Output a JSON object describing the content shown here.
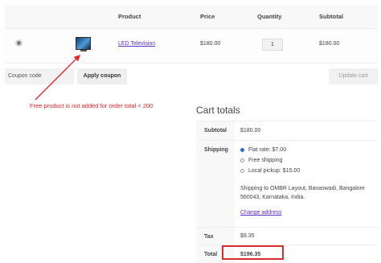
{
  "cart_table": {
    "headers": {
      "product": "Product",
      "price": "Price",
      "quantity": "Quantity",
      "subtotal": "Subtotal"
    },
    "rows": [
      {
        "product": "LED Television",
        "price": "$180.00",
        "quantity": "1",
        "subtotal": "$180.00"
      }
    ]
  },
  "actions": {
    "coupon_placeholder": "Coupon code",
    "apply_coupon": "Apply coupon",
    "update_cart": "Update cart"
  },
  "annotation": {
    "text": "Free product is not added for order total < 200",
    "color": "#e3242b"
  },
  "cart_totals": {
    "title": "Cart totals",
    "subtotal_label": "Subtotal",
    "subtotal_value": "$180.00",
    "shipping_label": "Shipping",
    "shipping_options": [
      {
        "label": "Flat rate: $7.00",
        "checked": true
      },
      {
        "label": "Free shipping",
        "checked": false
      },
      {
        "label": "Local pickup: $15.00",
        "checked": false
      }
    ],
    "shipping_to": "Shipping to OMBR Layout, Banaswadi, Bangalore 560043, Karnataka, India.",
    "change_address": "Change address",
    "tax_label": "Tax",
    "tax_value": "$9.35",
    "total_label": "Total",
    "total_value": "$196.35"
  },
  "colors": {
    "accent_link": "#5a2ec7",
    "highlight_border": "#d72e2e",
    "radio_selected": "#2a6bd8"
  }
}
